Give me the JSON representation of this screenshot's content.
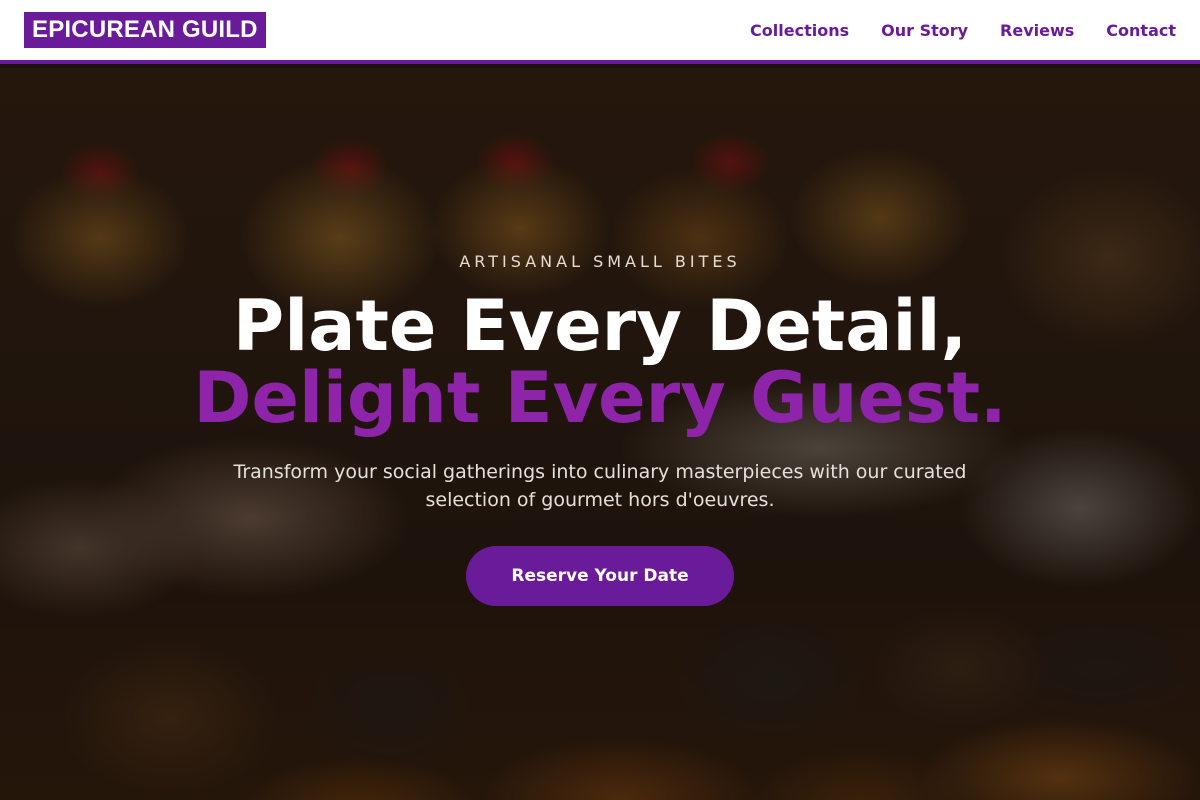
{
  "brand": {
    "name": "EPICUREAN GUILD",
    "color": "#6a1b9a"
  },
  "nav": {
    "items": [
      {
        "label": "Collections"
      },
      {
        "label": "Our Story"
      },
      {
        "label": "Reviews"
      },
      {
        "label": "Contact"
      }
    ]
  },
  "hero": {
    "eyebrow": "ARTISANAL SMALL BITES",
    "headline_line1": "Plate Every Detail,",
    "headline_line2": "Delight Every Guest.",
    "description": "Transform your social gatherings into culinary masterpieces with our curated selection of gourmet hors d'oeuvres.",
    "cta_label": "Reserve Your Date",
    "accent_color": "#8e24aa"
  }
}
